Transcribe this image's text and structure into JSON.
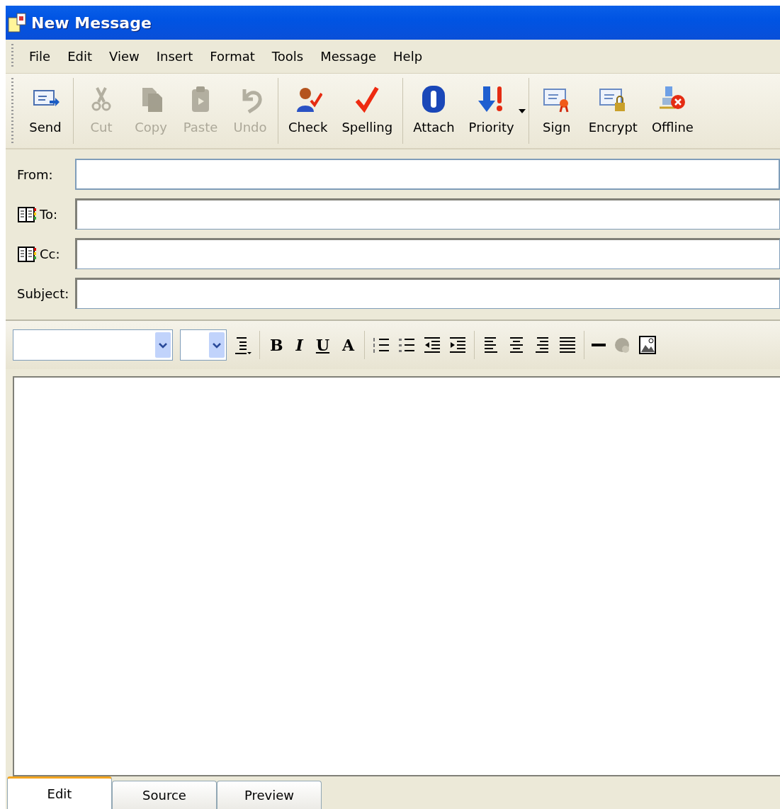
{
  "window": {
    "title": "New Message"
  },
  "menu": [
    "File",
    "Edit",
    "View",
    "Insert",
    "Format",
    "Tools",
    "Message",
    "Help"
  ],
  "toolbar": [
    {
      "label": "Send",
      "disabled": false
    },
    {
      "label": "Cut",
      "disabled": true
    },
    {
      "label": "Copy",
      "disabled": true
    },
    {
      "label": "Paste",
      "disabled": true
    },
    {
      "label": "Undo",
      "disabled": true
    },
    {
      "label": "Check",
      "disabled": false
    },
    {
      "label": "Spelling",
      "disabled": false
    },
    {
      "label": "Attach",
      "disabled": false
    },
    {
      "label": "Priority",
      "disabled": false
    },
    {
      "label": "Sign",
      "disabled": false
    },
    {
      "label": "Encrypt",
      "disabled": false
    },
    {
      "label": "Offline",
      "disabled": false
    }
  ],
  "fields": [
    {
      "label": "From:",
      "address_book": false
    },
    {
      "label": "To:",
      "address_book": true
    },
    {
      "label": "Cc:",
      "address_book": true
    },
    {
      "label": "Subject:",
      "address_book": false
    }
  ],
  "format_toolbar": {
    "text_buttons": [
      "B",
      "I",
      "U",
      "A"
    ]
  },
  "tabs": [
    {
      "label": "Edit",
      "selected": true
    },
    {
      "label": "Source",
      "selected": false
    },
    {
      "label": "Preview",
      "selected": false
    }
  ]
}
